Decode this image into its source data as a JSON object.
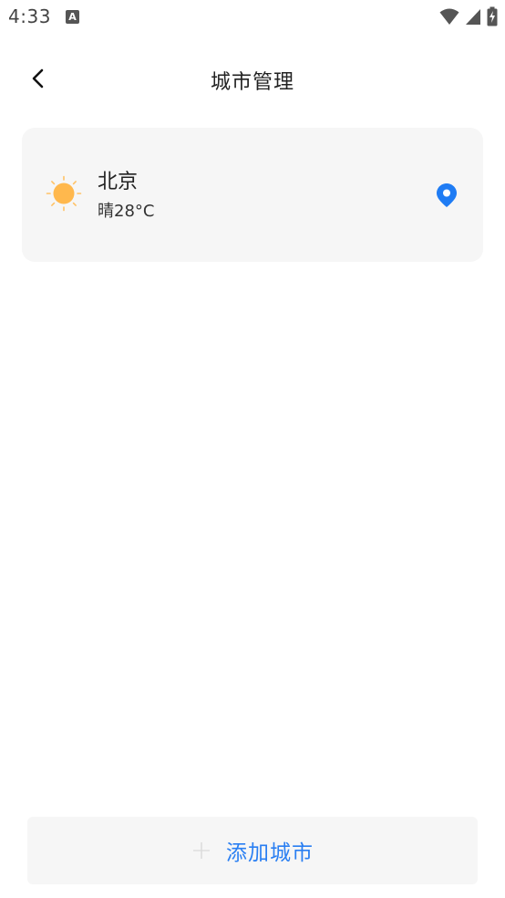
{
  "status_bar": {
    "time": "4:33",
    "notification_icon": "A"
  },
  "header": {
    "title": "城市管理",
    "back_icon": "chevron-left-icon"
  },
  "cities": [
    {
      "name": "北京",
      "weather": "晴28°C",
      "icon": "sun-icon",
      "is_location": true
    }
  ],
  "add_button": {
    "label": "添加城市",
    "icon": "plus-icon"
  },
  "colors": {
    "accent": "#2a7ff2",
    "card_bg": "#f6f6f6",
    "sun": "#ffb84d"
  }
}
